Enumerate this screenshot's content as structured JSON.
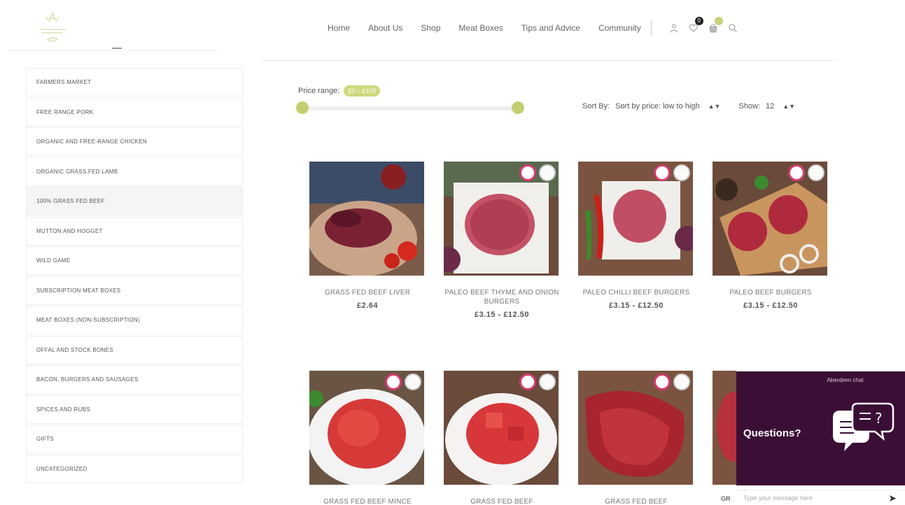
{
  "nav": {
    "items": [
      "Home",
      "About Us",
      "Shop",
      "Meat Boxes",
      "Tips and Advice",
      "Community"
    ],
    "cart_count": "0"
  },
  "sidebar": {
    "categories": [
      "FARMERS MARKET",
      "FREE RANGE PORK",
      "ORGANIC AND FREE-RANGE CHICKEN",
      "ORGANIC GRASS FED LAMB",
      "100% GRASS FED BEEF",
      "MUTTON AND HOGGET",
      "WILD GAME",
      "SUBSCRIPTION MEAT BOXES",
      "MEAT BOXES (NON-SUBSCRIPTION)",
      "OFFAL AND STOCK BONES",
      "BACON, BURGERS AND SAUSAGES",
      "SPICES AND RUBS",
      "GIFTS",
      "UNCATEGORIZED"
    ],
    "active_index": 4
  },
  "filters": {
    "price_label": "Price range:",
    "price_range": "£0 – £100",
    "slider_min": 0,
    "slider_max": 1,
    "sort_label": "Sort By:",
    "sort_value": "Sort by price: low to high",
    "show_label": "Show:",
    "show_value": "12"
  },
  "products": [
    {
      "name": "GRASS FED BEEF LIVER",
      "price": "£2.64"
    },
    {
      "name": "PALEO BEEF THYME AND ONION BURGERS",
      "price": "£3.15 - £12.50"
    },
    {
      "name": "PALEO CHILLI BEEF BURGERS",
      "price": "£3.15 - £12.50"
    },
    {
      "name": "PALEO BEEF BURGERS",
      "price": "£3.15 - £12.50"
    },
    {
      "name": "GRASS FED BEEF MINCE",
      "price": ""
    },
    {
      "name": "GRASS FED BEEF",
      "price": ""
    },
    {
      "name": "GRASS FED BEEF",
      "price": ""
    },
    {
      "name": "GR",
      "price": ""
    }
  ],
  "chat": {
    "header": "Aberdeen chat",
    "question": "Questions?",
    "input_placeholder": "Type your message here",
    "send_icon": "send-arrow-icon"
  },
  "colors": {
    "accent": "#c8d27a",
    "chat_bg": "#3b0e35"
  }
}
